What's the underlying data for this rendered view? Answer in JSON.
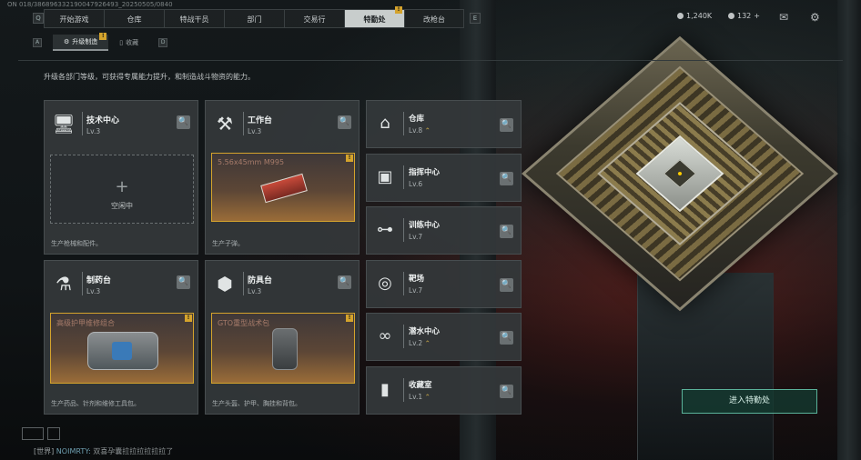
{
  "session_id": "ON 018/38689633219004792649​3_20250505/0840",
  "nav": {
    "key_left": "Q",
    "key_right": "E",
    "tabs": [
      {
        "label": "开始游戏",
        "active": false
      },
      {
        "label": "仓库",
        "active": false
      },
      {
        "label": "特战干员",
        "active": false
      },
      {
        "label": "部门",
        "active": false
      },
      {
        "label": "交易行",
        "active": false
      },
      {
        "label": "特勤处",
        "active": true,
        "badge": "!"
      },
      {
        "label": "改枪台",
        "active": false
      }
    ]
  },
  "resources": {
    "currency": "1,240K",
    "points": "132",
    "points_plus": "+"
  },
  "subnav": {
    "key_left": "A",
    "key_right": "D",
    "tabs": [
      {
        "label": "升级制造",
        "active": true,
        "badge": "!"
      },
      {
        "label": "收藏",
        "active": false
      }
    ]
  },
  "intro": "升级各部门等级，可获得专属能力提升，和制造战斗物资的能力。",
  "work_stations": [
    {
      "name": "技术中心",
      "level": "Lv.3",
      "slot_label": "空闲中",
      "desc": "生产枪械和配件。"
    },
    {
      "name": "工作台",
      "level": "Lv.3",
      "item": "5.56x45mm M995",
      "badge": "!",
      "desc": "生产子弹。"
    },
    {
      "name": "制药台",
      "level": "Lv.3",
      "item": "高级护甲维修组合",
      "badge": "!",
      "desc": "生产药品、针剂和维修工具包。"
    },
    {
      "name": "防具台",
      "level": "Lv.3",
      "item": "GTO重型战术包",
      "badge": "!",
      "desc": "生产头盔、护甲、胸挂和背包。"
    }
  ],
  "facilities": [
    {
      "name": "仓库",
      "level": "Lv.8",
      "upgradable": true
    },
    {
      "name": "指挥中心",
      "level": "Lv.6",
      "upgradable": false
    },
    {
      "name": "训练中心",
      "level": "Lv.7",
      "upgradable": false
    },
    {
      "name": "靶场",
      "level": "Lv.7",
      "upgradable": false
    },
    {
      "name": "潜水中心",
      "level": "Lv.2",
      "upgradable": true
    },
    {
      "name": "收藏室",
      "level": "Lv.1",
      "upgradable": true
    }
  ],
  "enter_button": "进入特勤处",
  "chat": {
    "channel": "[世界]",
    "nick": "NOIMRTY:",
    "message": "双喜孕囊拉拉拉拉拉拉了"
  },
  "colors": {
    "accent": "#d4a32c",
    "enter_border": "#5ab29a",
    "active_tab_bg": "#c8cdcc"
  }
}
